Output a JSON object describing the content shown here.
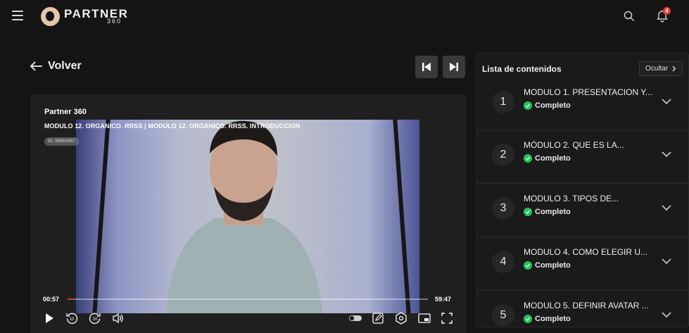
{
  "app": {
    "brand": "PARTNER",
    "brand_sub": "360",
    "notifications": "4"
  },
  "nav": {
    "back_label": "Volver"
  },
  "player": {
    "title": "Partner 360",
    "subtitle": "MODULO 12. ORGANICO. RRSS | MODULO 12. ORGANICO. RRSS. INTRODUCCION",
    "id_badge": "ID: 85850957",
    "time_current": "00:57",
    "time_total": "59:47",
    "progress": 0.016,
    "accent_color": "#d23b2a"
  },
  "panel": {
    "title": "Lista de contenidos",
    "hide_label": "Ocultar",
    "modules": [
      {
        "num": "1",
        "title": "MODULO 1. PRESENTACION Y...",
        "status": "Completo"
      },
      {
        "num": "2",
        "title": "MÓDULO 2. QUE ES LA...",
        "status": "Completo"
      },
      {
        "num": "3",
        "title": "MODULO 3. TIPOS DE...",
        "status": "Completo"
      },
      {
        "num": "4",
        "title": "MODULO 4. COMO ELEGIR U...",
        "status": "Completo"
      },
      {
        "num": "5",
        "title": "MODULO 5. DEFINIR AVATAR ...",
        "status": "Completo"
      }
    ]
  },
  "icons": [
    "menu-icon",
    "search-icon",
    "bell-icon",
    "arrow-left-icon",
    "skip-previous-icon",
    "skip-next-icon",
    "play-icon",
    "rewind-10-icon",
    "forward-10-icon",
    "volume-icon",
    "toggle-icon",
    "notes-icon",
    "settings-icon",
    "pip-icon",
    "fullscreen-icon",
    "check-icon",
    "chevron-down-icon",
    "chevron-right-icon"
  ],
  "colors": {
    "complete": "#22c55e",
    "badge": "#e53935"
  }
}
